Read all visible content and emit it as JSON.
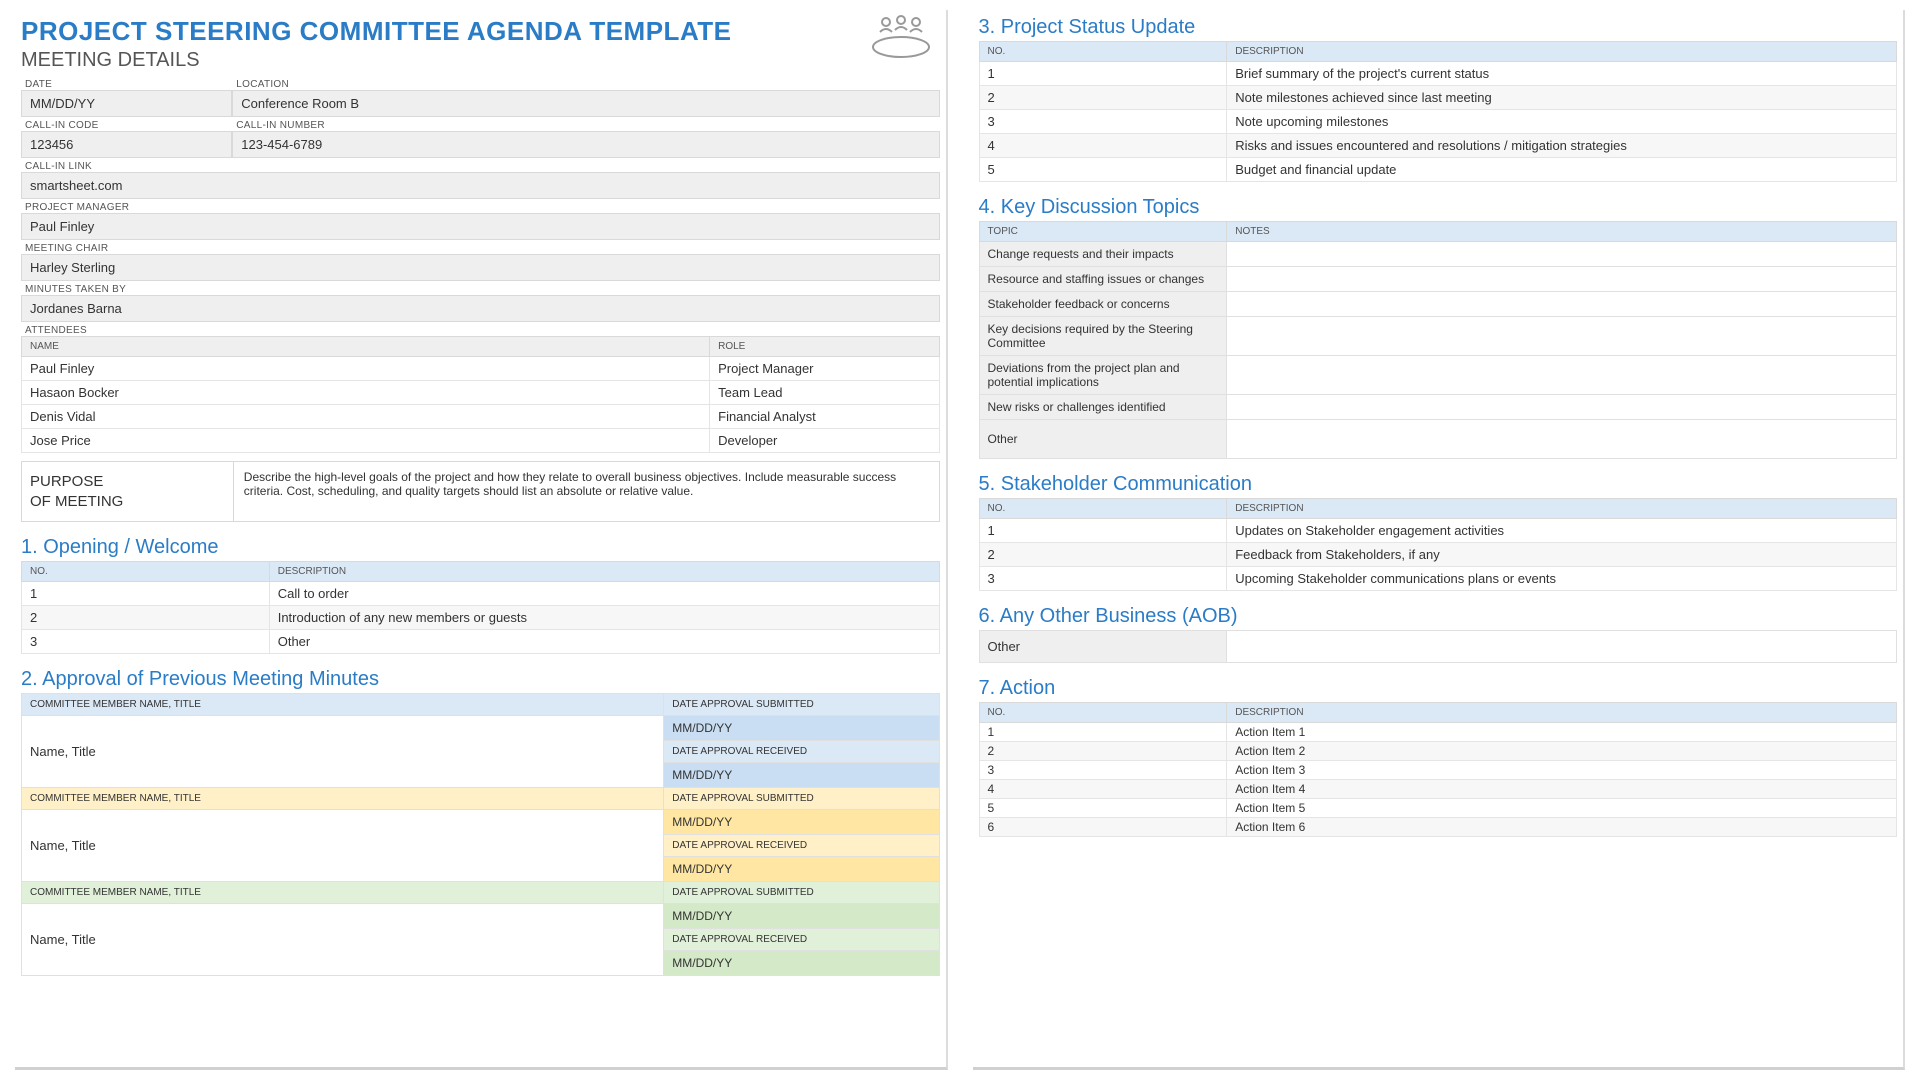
{
  "title": "PROJECT STEERING COMMITTEE AGENDA TEMPLATE",
  "subtitle": "MEETING DETAILS",
  "details": {
    "date_label": "DATE",
    "date": "MM/DD/YY",
    "location_label": "LOCATION",
    "location": "Conference Room B",
    "code_label": "CALL-IN CODE",
    "code": "123456",
    "number_label": "CALL-IN NUMBER",
    "number": "123-454-6789",
    "link_label": "CALL-IN LINK",
    "link": "smartsheet.com",
    "pm_label": "PROJECT MANAGER",
    "pm": "Paul Finley",
    "chair_label": "MEETING CHAIR",
    "chair": "Harley Sterling",
    "minutes_label": "MINUTES TAKEN BY",
    "minutes": "Jordanes Barna",
    "attendees_label": "ATTENDEES",
    "att_name": "NAME",
    "att_role": "ROLE",
    "attendees": [
      {
        "name": "Paul Finley",
        "role": "Project Manager"
      },
      {
        "name": "Hasaon Bocker",
        "role": "Team Lead"
      },
      {
        "name": "Denis Vidal",
        "role": "Financial Analyst"
      },
      {
        "name": "Jose Price",
        "role": "Developer"
      }
    ],
    "purpose_label1": "PURPOSE",
    "purpose_label2": "OF MEETING",
    "purpose": "Describe the high-level goals of the project and how they relate to overall business objectives.  Include measurable success criteria.  Cost, scheduling, and quality targets should list an absolute or relative value."
  },
  "s1": {
    "title": "1. Opening / Welcome",
    "no": "NO.",
    "desc": "DESCRIPTION",
    "rows": [
      {
        "n": "1",
        "d": "Call to order"
      },
      {
        "n": "2",
        "d": "Introduction of any new members or guests"
      },
      {
        "n": "3",
        "d": "Other"
      }
    ]
  },
  "s2": {
    "title": "2. Approval of Previous Meeting Minutes",
    "memhdr": "COMMITTEE MEMBER NAME, TITLE",
    "sub": "DATE APPROVAL SUBMITTED",
    "rec": "DATE APPROVAL RECEIVED",
    "name": "Name, Title",
    "date": "MM/DD/YY"
  },
  "s3": {
    "title": "3. Project Status Update",
    "no": "NO.",
    "desc": "DESCRIPTION",
    "rows": [
      {
        "n": "1",
        "d": "Brief summary of the project's current status"
      },
      {
        "n": "2",
        "d": "Note milestones achieved since last meeting"
      },
      {
        "n": "3",
        "d": "Note upcoming milestones"
      },
      {
        "n": "4",
        "d": "Risks and issues encountered and resolutions / mitigation strategies"
      },
      {
        "n": "5",
        "d": "Budget and financial update"
      }
    ]
  },
  "s4": {
    "title": "4. Key Discussion Topics",
    "topic": "TOPIC",
    "notes": "NOTES",
    "rows": [
      "Change requests and their impacts",
      "Resource and staffing issues or changes",
      "Stakeholder feedback or concerns",
      "Key decisions required by the Steering Committee",
      "Deviations from the project plan and potential implications",
      "New risks or challenges identified",
      "Other"
    ]
  },
  "s5": {
    "title": "5. Stakeholder Communication",
    "no": "NO.",
    "desc": "DESCRIPTION",
    "rows": [
      {
        "n": "1",
        "d": "Updates on Stakeholder engagement activities"
      },
      {
        "n": "2",
        "d": "Feedback from Stakeholders, if any"
      },
      {
        "n": "3",
        "d": "Upcoming Stakeholder communications plans or events"
      }
    ]
  },
  "s6": {
    "title": "6. Any Other Business (AOB)",
    "other": "Other"
  },
  "s7": {
    "title": "7. Action",
    "no": "NO.",
    "desc": "DESCRIPTION",
    "rows": [
      {
        "n": "1",
        "d": "Action Item 1"
      },
      {
        "n": "2",
        "d": "Action Item 2"
      },
      {
        "n": "3",
        "d": "Action Item 3"
      },
      {
        "n": "4",
        "d": "Action Item 4"
      },
      {
        "n": "5",
        "d": "Action Item 5"
      },
      {
        "n": "6",
        "d": "Action Item 6"
      }
    ]
  }
}
